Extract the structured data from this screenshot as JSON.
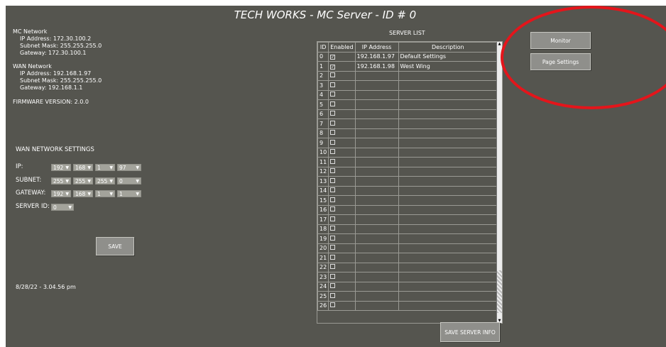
{
  "title": "TECH WORKS - MC Server - ID # 0",
  "mc_network": {
    "heading": "MC Network",
    "ip": "IP Address: 172.30.100.2",
    "mask": "Subnet Mask: 255.255.255.0",
    "gateway": "Gateway: 172.30.100.1"
  },
  "wan_network": {
    "heading": "WAN Network",
    "ip": "IP Address: 192.168.1.97",
    "mask": "Subnet Mask: 255.255.255.0",
    "gateway": "Gateway: 192.168.1.1"
  },
  "firmware": "FIRMWARE VERSION: 2.0.0",
  "wan_settings": {
    "heading": "WAN NETWORK SETTINGS",
    "ip_label": "IP:",
    "ip": [
      "192",
      "168",
      "1",
      "97"
    ],
    "subnet_label": "SUBNET:",
    "subnet": [
      "255",
      "255",
      "255",
      "0"
    ],
    "gateway_label": "GATEWAY:",
    "gateway": [
      "192",
      "168",
      "1",
      "1"
    ],
    "server_id_label": "SERVER ID:",
    "server_id": "0",
    "save_label": "SAVE"
  },
  "timestamp": "8/28/22 - 3.04.56 pm",
  "server_list": {
    "heading": "SERVER LIST",
    "columns": [
      "ID",
      "Enabled",
      "IP Address",
      "Description"
    ],
    "rows": [
      {
        "id": "0",
        "enabled": true,
        "ip": "192.168.1.97",
        "desc": "Default Settings"
      },
      {
        "id": "1",
        "enabled": true,
        "ip": "192.168.1.98",
        "desc": "West Wing"
      },
      {
        "id": "2",
        "enabled": false,
        "ip": "",
        "desc": ""
      },
      {
        "id": "3",
        "enabled": false,
        "ip": "",
        "desc": ""
      },
      {
        "id": "4",
        "enabled": false,
        "ip": "",
        "desc": ""
      },
      {
        "id": "5",
        "enabled": false,
        "ip": "",
        "desc": ""
      },
      {
        "id": "6",
        "enabled": false,
        "ip": "",
        "desc": ""
      },
      {
        "id": "7",
        "enabled": false,
        "ip": "",
        "desc": ""
      },
      {
        "id": "8",
        "enabled": false,
        "ip": "",
        "desc": ""
      },
      {
        "id": "9",
        "enabled": false,
        "ip": "",
        "desc": ""
      },
      {
        "id": "10",
        "enabled": false,
        "ip": "",
        "desc": ""
      },
      {
        "id": "11",
        "enabled": false,
        "ip": "",
        "desc": ""
      },
      {
        "id": "12",
        "enabled": false,
        "ip": "",
        "desc": ""
      },
      {
        "id": "13",
        "enabled": false,
        "ip": "",
        "desc": ""
      },
      {
        "id": "14",
        "enabled": false,
        "ip": "",
        "desc": ""
      },
      {
        "id": "15",
        "enabled": false,
        "ip": "",
        "desc": ""
      },
      {
        "id": "16",
        "enabled": false,
        "ip": "",
        "desc": ""
      },
      {
        "id": "17",
        "enabled": false,
        "ip": "",
        "desc": ""
      },
      {
        "id": "18",
        "enabled": false,
        "ip": "",
        "desc": ""
      },
      {
        "id": "19",
        "enabled": false,
        "ip": "",
        "desc": ""
      },
      {
        "id": "20",
        "enabled": false,
        "ip": "",
        "desc": ""
      },
      {
        "id": "21",
        "enabled": false,
        "ip": "",
        "desc": ""
      },
      {
        "id": "22",
        "enabled": false,
        "ip": "",
        "desc": ""
      },
      {
        "id": "23",
        "enabled": false,
        "ip": "",
        "desc": ""
      },
      {
        "id": "24",
        "enabled": false,
        "ip": "",
        "desc": ""
      },
      {
        "id": "25",
        "enabled": false,
        "ip": "",
        "desc": ""
      },
      {
        "id": "26",
        "enabled": false,
        "ip": "",
        "desc": ""
      }
    ],
    "save_label": "SAVE SERVER INFO"
  },
  "buttons": {
    "monitor": "Monitor",
    "page_settings": "Page Settings"
  },
  "colors": {
    "background": "#55554f",
    "button": "#8f8f8b",
    "annotation_circle": "#e4151b"
  }
}
